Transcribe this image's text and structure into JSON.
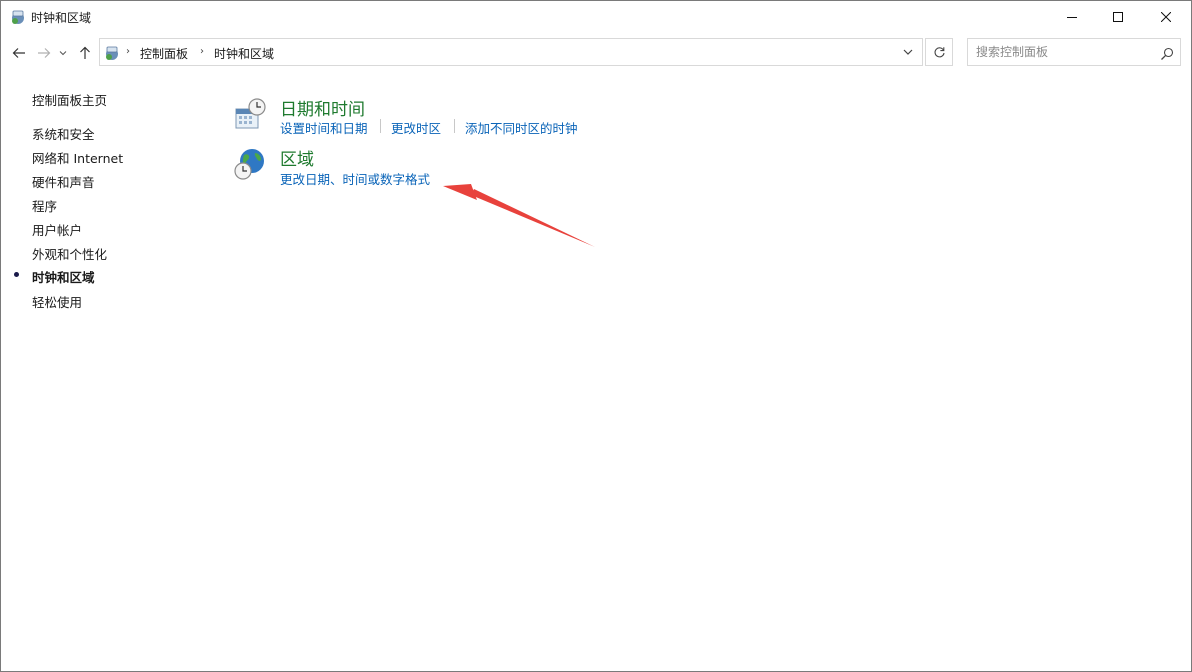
{
  "window": {
    "title": "时钟和区域"
  },
  "address": {
    "crumbs": [
      "控制面板",
      "时钟和区域"
    ]
  },
  "search": {
    "placeholder": "搜索控制面板"
  },
  "sidebar": {
    "home": "控制面板主页",
    "items": [
      {
        "label": "系统和安全"
      },
      {
        "label": "网络和 Internet"
      },
      {
        "label": "硬件和声音"
      },
      {
        "label": "程序"
      },
      {
        "label": "用户帐户"
      },
      {
        "label": "外观和个性化"
      },
      {
        "label": "时钟和区域",
        "active": true
      },
      {
        "label": "轻松使用"
      }
    ]
  },
  "main": {
    "categories": [
      {
        "title": "日期和时间",
        "icon": "calendar-clock-icon",
        "links": [
          "设置时间和日期",
          "更改时区",
          "添加不同时区的时钟"
        ]
      },
      {
        "title": "区域",
        "icon": "globe-clock-icon",
        "links": [
          "更改日期、时间或数字格式"
        ]
      }
    ]
  },
  "colors": {
    "category_title": "#1e7a2e",
    "link": "#0a64b8",
    "annotation_arrow": "#e8423c"
  }
}
